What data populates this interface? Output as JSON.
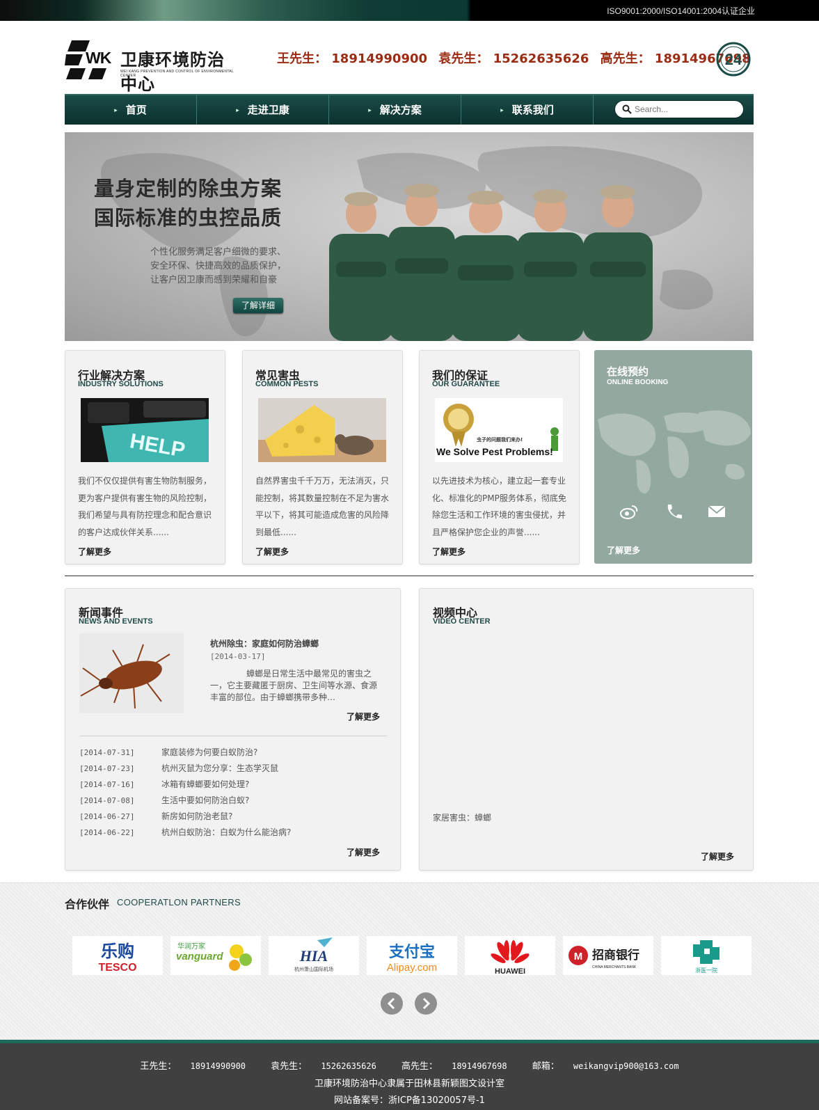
{
  "topbar": {
    "cert": "ISO9001:2000/ISO14001:2004认证企业"
  },
  "header": {
    "logo_mark": "WK",
    "logo_cn": "卫康环境防治中心",
    "logo_en": "WEI KANG PREVENTION AND CONTROL OF ENVIRONMENTAL CENTER",
    "phones": [
      "王先生： 18914990900",
      "袁先生： 15262635626",
      "高先生： 18914967698"
    ],
    "badge": "24"
  },
  "nav": {
    "items": [
      "首页",
      "走进卫康",
      "解决方案",
      "联系我们"
    ],
    "search_placeholder": "Search..."
  },
  "banner": {
    "title_line1": "量身定制的除虫方案",
    "title_line2": "国际标准的虫控品质",
    "sub_line1": "个性化服务满足客户细微的要求、",
    "sub_line2": "安全环保、快捷高效的品质保护，",
    "sub_line3": "让客户因卫康而感到荣耀和自豪",
    "button": "了解详细"
  },
  "cards": [
    {
      "title": "行业解决方案",
      "title_en": "INDUSTRY SOLUTIONS",
      "img_text": "HELP",
      "desc": "我们不仅仅提供有害生物防制服务，更为客户提供有害生物的风险控制，我们希望与具有防控理念和配合意识的客户达成伙伴关系......",
      "more": "了解更多"
    },
    {
      "title": "常见害虫",
      "title_en": "COMMON PESTS",
      "desc": "自然界害虫千千万万，无法消灭，只能控制，将其数量控制在不足为害水平以下，将其可能造成危害的风险降到最低......",
      "more": "了解更多"
    },
    {
      "title": "我们的保证",
      "title_en": "OUR GUARANTEE",
      "img_text_cn": "虫子的问题我们来办!",
      "img_text_en": "We Solve Pest Problems!",
      "desc": "以先进技术为核心，建立起一套专业化、标准化的PMP服务体系，彻底免除您生活和工作环境的害虫侵扰，并且严格保护您企业的声誉......",
      "more": "了解更多"
    }
  ],
  "booking": {
    "title": "在线预约",
    "title_en": "ONLINE BOOKING",
    "more": "了解更多",
    "icons": [
      "weibo-icon",
      "phone-icon",
      "mail-icon"
    ]
  },
  "news": {
    "title": "新闻事件",
    "title_en": "NEWS AND EVENTS",
    "featured": {
      "title": "杭州除虫：家庭如何防治蟑螂",
      "date": "[2014-03-17]",
      "text": "蟑螂是日常生活中最常见的害虫之一，它主要藏匿于厨房、卫生间等水源、食源丰富的部位。由于蟑螂携带多种…",
      "more": "了解更多"
    },
    "list": [
      {
        "date": "[2014-07-31]",
        "title": "家庭装修为何要白蚁防治?"
      },
      {
        "date": "[2014-07-23]",
        "title": "杭州灭鼠为您分享：生态学灭鼠"
      },
      {
        "date": "[2014-07-16]",
        "title": "冰箱有蟑螂要如何处理?"
      },
      {
        "date": "[2014-07-08]",
        "title": "生活中要如何防治白蚁?"
      },
      {
        "date": "[2014-06-27]",
        "title": "新房如何防治老鼠?"
      },
      {
        "date": "[2014-06-22]",
        "title": "杭州白蚁防治：白蚁为什么能治病?"
      }
    ],
    "more": "了解更多"
  },
  "video": {
    "title": "视频中心",
    "title_en": "VIDEO CENTER",
    "caption": "家居害虫：蟑螂",
    "more": "了解更多"
  },
  "partners": {
    "title": "合作伙伴",
    "title_en": "COOPERATLON PARTNERS",
    "logos": [
      {
        "name": "tesco",
        "cn": "乐购",
        "en": "TESCO"
      },
      {
        "name": "vanguard",
        "cn": "华润万家",
        "en": "vanguard"
      },
      {
        "name": "hia",
        "cn": "HIA",
        "en": "杭州萧山国际机场"
      },
      {
        "name": "alipay",
        "cn": "支付宝",
        "en": "Alipay.com"
      },
      {
        "name": "huawei",
        "cn": "",
        "en": "HUAWEI"
      },
      {
        "name": "cmb",
        "cn": "招商银行",
        "en": "CHINA MERCHANTS BANK"
      },
      {
        "name": "zheyi",
        "cn": "浙医一院",
        "en": ""
      }
    ]
  },
  "footer": {
    "contacts": [
      {
        "label": "王先生：",
        "value": "18914990900"
      },
      {
        "label": "袁先生：",
        "value": "15262635626"
      },
      {
        "label": "高先生：",
        "value": "18914967698"
      },
      {
        "label": "邮箱：",
        "value": "weikangvip900@163.com"
      }
    ],
    "line2": "卫康环境防治中心隶属于田林县新颖图文设计室",
    "line3": "网站备案号：浙ICP备13020057号-1"
  }
}
